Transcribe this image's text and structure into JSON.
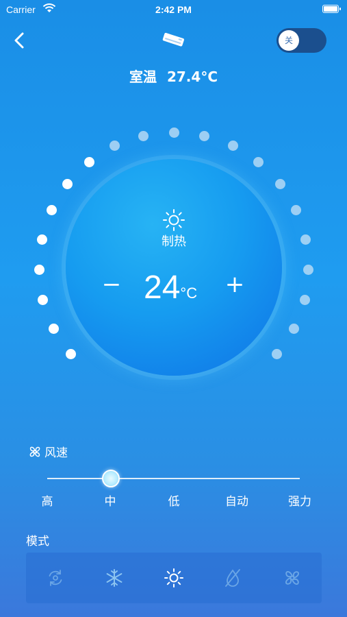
{
  "status_bar": {
    "carrier": "Carrier",
    "time": "2:42 PM"
  },
  "nav": {
    "back_icon": "chevron-left-icon",
    "device_icon": "air-conditioner-icon",
    "power_toggle_label": "关",
    "power_state": "off"
  },
  "room_temperature": {
    "label": "室温",
    "value": "27.4°C"
  },
  "dial": {
    "mode_icon": "sun-icon",
    "mode_label": "制热",
    "minus_label": "−",
    "plus_label": "+",
    "temperature": "24",
    "unit": "°C"
  },
  "fan_speed": {
    "title": "风速",
    "icon": "fan-icon",
    "levels": [
      "高",
      "中",
      "低",
      "自动",
      "强力"
    ],
    "selected_index": 1
  },
  "mode": {
    "title": "模式",
    "options": [
      {
        "icon": "auto-cycle-icon",
        "name": "auto"
      },
      {
        "icon": "snowflake-icon",
        "name": "cool"
      },
      {
        "icon": "sun-icon",
        "name": "heat",
        "active": true
      },
      {
        "icon": "dry-icon",
        "name": "dry"
      },
      {
        "icon": "fan-icon",
        "name": "fan"
      }
    ]
  },
  "colors": {
    "background_top": "#1a8ee6",
    "background_bottom": "#3b78db",
    "dial_center": "#169cf0",
    "toggle_bg": "#1b4f8e"
  }
}
